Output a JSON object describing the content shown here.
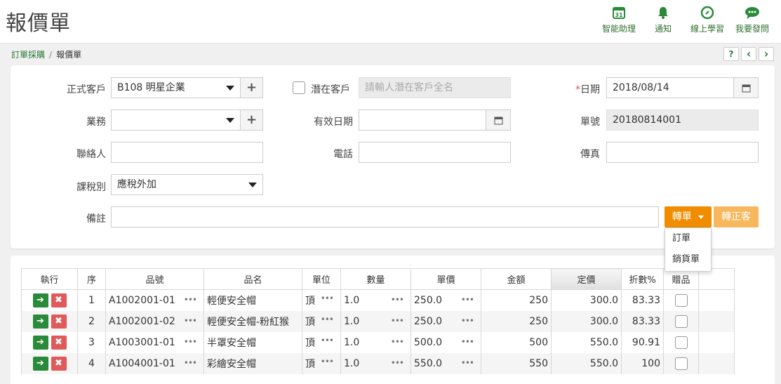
{
  "page_title": "報價單",
  "toolbar": [
    {
      "name": "assistant",
      "label": "智能助理",
      "icon": "calendar-31-icon"
    },
    {
      "name": "notify",
      "label": "通知",
      "icon": "bell-icon"
    },
    {
      "name": "learning",
      "label": "線上學習",
      "icon": "compass-icon"
    },
    {
      "name": "ask",
      "label": "我要發問",
      "icon": "chat-icon"
    }
  ],
  "breadcrumb": {
    "parent": "訂單採購",
    "separator": "/",
    "current": "報價單"
  },
  "nav": {
    "help": "?",
    "prev": "‹",
    "next": "›"
  },
  "form": {
    "customer_label": "正式客戶",
    "customer_value": "B108 明星企業",
    "prospect_label": "潛在客戶",
    "prospect_placeholder": "請輸人潛在客戶全名",
    "date_required_mark": "*",
    "date_label": "日期",
    "date_value": "2018/08/14",
    "sales_label": "業務",
    "sales_value": "",
    "valid_label": "有效日期",
    "valid_value": "",
    "number_label": "單號",
    "number_value": "20180814001",
    "contact_label": "聯絡人",
    "contact_value": "",
    "phone_label": "電話",
    "phone_value": "",
    "fax_label": "傳真",
    "fax_value": "",
    "tax_label": "課稅別",
    "tax_value": "應稅外加",
    "memo_label": "備註",
    "memo_value": ""
  },
  "actions": {
    "convert_label": "轉單",
    "to_customer_label": "轉正客",
    "dropdown": [
      "訂單",
      "銷貨單"
    ]
  },
  "colors": {
    "green": "#2a8a3a",
    "red": "#e05a5a",
    "orange": "#f08c00",
    "orange_light": "#f7b85d"
  },
  "table": {
    "headers": [
      "執行",
      "序",
      "品號",
      "品名",
      "單位",
      "數量",
      "單價",
      "金額",
      "定價",
      "折數%",
      "贈品"
    ],
    "rows": [
      {
        "seq": "1",
        "code": "A1002001-01",
        "name": "輕便安全帽",
        "unit": "頂",
        "qty": "1.0",
        "price": "250.0",
        "amount": "250",
        "list": "300.0",
        "disc": "83.33"
      },
      {
        "seq": "2",
        "code": "A1002001-02",
        "name": "輕便安全帽-粉紅猴",
        "unit": "頂",
        "qty": "1.0",
        "price": "250.0",
        "amount": "250",
        "list": "300.0",
        "disc": "83.33"
      },
      {
        "seq": "3",
        "code": "A1003001-01",
        "name": "半罩安全帽",
        "unit": "頂",
        "qty": "1.0",
        "price": "500.0",
        "amount": "500",
        "list": "550.0",
        "disc": "90.91"
      },
      {
        "seq": "4",
        "code": "A1004001-01",
        "name": "彩繪安全帽",
        "unit": "頂",
        "qty": "1.0",
        "price": "550.0",
        "amount": "550",
        "list": "550.0",
        "disc": "100"
      }
    ]
  }
}
